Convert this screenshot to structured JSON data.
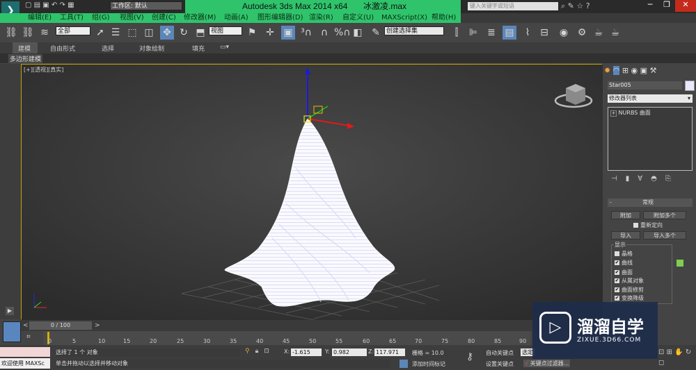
{
  "titlebar": {
    "workspace_label": "工作区: 默认",
    "title": "Autodesk 3ds Max  2014 x64",
    "file_name": "冰激凌.max",
    "search_placeholder": "键入关键字或短语"
  },
  "menu": [
    "编辑(E)",
    "工具(T)",
    "组(G)",
    "视图(V)",
    "创建(C)",
    "修改器(M)",
    "动画(A)",
    "图形编辑器(D)",
    "渲染(R)",
    "自定义(U)",
    "MAXScript(X)",
    "帮助(H)"
  ],
  "toolbar": {
    "selection_filter": "全部",
    "reference_coord": "视图",
    "named_selection": "创建选择集"
  },
  "ribbon": {
    "tabs": [
      "建模",
      "自由形式",
      "选择",
      "对象绘制",
      "填充"
    ],
    "sub_label": "多边形建模"
  },
  "viewport": {
    "label": "[+][透视][真实]"
  },
  "command_panel": {
    "object_name": "Star005",
    "modifier_list": "修改器列表",
    "stack_item": "NURBS 曲面",
    "rollout_title": "常规",
    "attach": "附加",
    "attach_multiple": "附加多个",
    "reorient": "重新定向",
    "import": "导入",
    "import_multiple": "导入多个",
    "display_group": "显示",
    "checks": [
      {
        "label": "晶格",
        "checked": false
      },
      {
        "label": "曲线",
        "checked": true
      },
      {
        "label": "曲面",
        "checked": true
      },
      {
        "label": "从属对象",
        "checked": true
      },
      {
        "label": "曲面修剪",
        "checked": true
      },
      {
        "label": "变换降级",
        "checked": true
      }
    ]
  },
  "timeline": {
    "position": "0 / 100",
    "ticks": [
      "0",
      "5",
      "10",
      "15",
      "20",
      "25",
      "30",
      "35",
      "40",
      "45",
      "50",
      "55",
      "60",
      "65",
      "70",
      "75",
      "80",
      "85",
      "90"
    ]
  },
  "status": {
    "welcome": "欢迎使用 MAXSc",
    "selected": "选择了 1 个 对象",
    "hint": "单击并拖动以选择并移动对象",
    "x_label": "X:",
    "x_value": "-1.615",
    "y_label": "Y:",
    "y_value": "0.982",
    "z_label": "Z:",
    "z_value": "117.971",
    "grid": "栅格 = 10.0",
    "auto_key": "自动关键点",
    "set_key": "设置关键点",
    "add_time_tag": "添加时间标记",
    "selected_dropdown": "选定",
    "key_filters": "关键点过滤器..."
  },
  "watermark": {
    "name": "溜溜自学",
    "url": "ZIXUE.3D66.COM"
  }
}
